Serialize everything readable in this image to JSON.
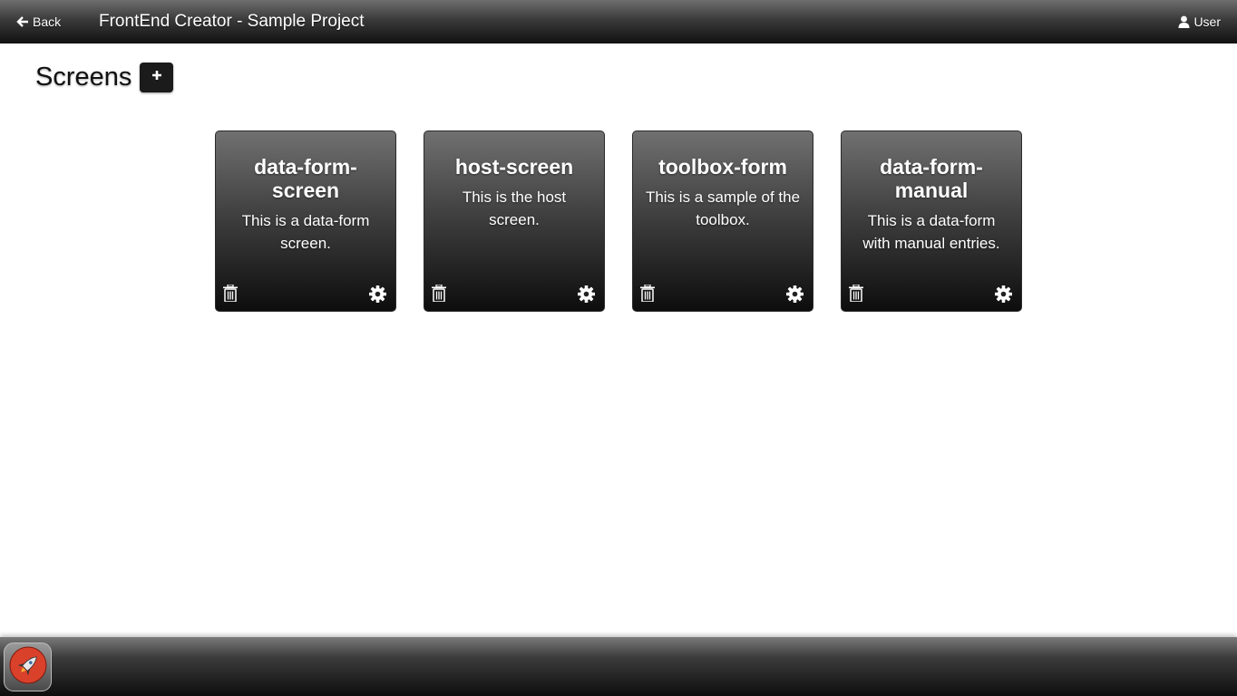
{
  "topbar": {
    "back_label": "Back",
    "title": "FrontEnd Creator - Sample Project",
    "user_label": "User"
  },
  "main": {
    "heading": "Screens",
    "add_label": "+",
    "cards": [
      {
        "title": "data-form-screen",
        "title_display": "data-form-\nscreen",
        "description": "This is a data-form screen."
      },
      {
        "title": "host-screen",
        "title_display": "host-screen",
        "description": "This is the host screen."
      },
      {
        "title": "toolbox-form",
        "title_display": "toolbox-form",
        "description": "This is a sample of the toolbox."
      },
      {
        "title": "data-form-manual",
        "title_display": "data-form-\nmanual",
        "description": "This is a data-form with manual entries."
      }
    ]
  },
  "dock": {
    "apps": [
      {
        "icon": "rocket-icon",
        "accent": "#d9412b"
      }
    ]
  },
  "colors": {
    "card_top": "#707070",
    "card_bottom": "#0d0d0d",
    "bar_dark": "#111111"
  }
}
